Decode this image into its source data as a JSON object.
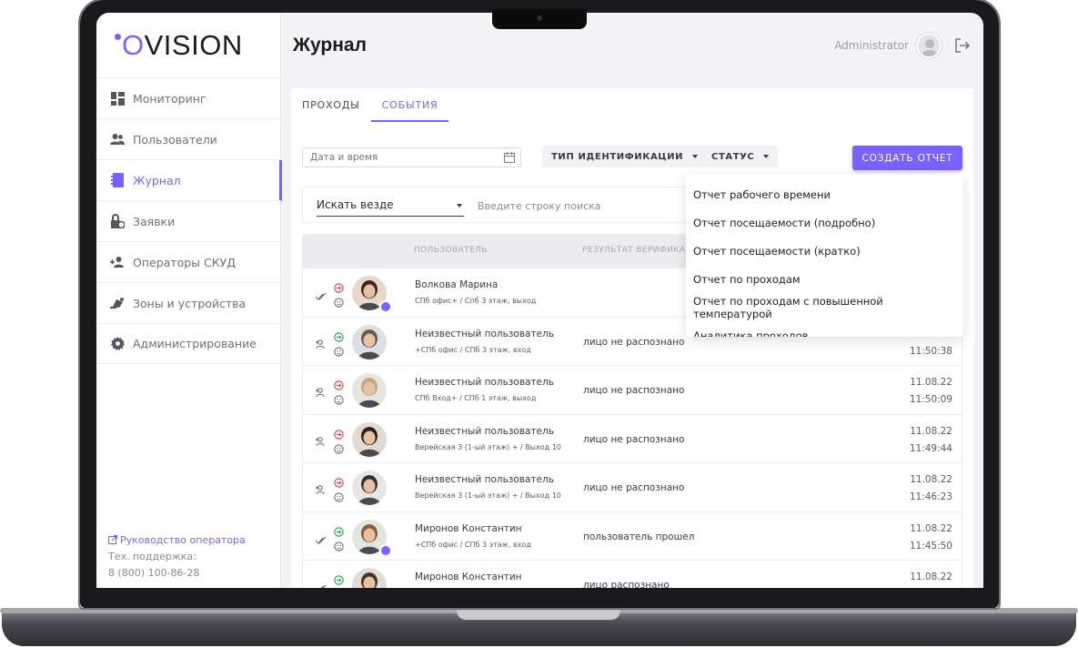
{
  "app": {
    "logo_text": "VISION",
    "logo_letter": "O",
    "accent_color": "#7b61ff"
  },
  "sidebar": {
    "items": [
      {
        "label": "Мониторинг",
        "icon": "dashboard-icon"
      },
      {
        "label": "Пользователи",
        "icon": "users-icon"
      },
      {
        "label": "Журнал",
        "icon": "journal-icon",
        "active": true
      },
      {
        "label": "Заявки",
        "icon": "request-icon"
      },
      {
        "label": "Операторы СКУД",
        "icon": "operator-icon"
      },
      {
        "label": "Зоны и устройства",
        "icon": "zones-icon"
      },
      {
        "label": "Администрирование",
        "icon": "gear-icon"
      }
    ],
    "footer": {
      "guide_link": "Руководство оператора",
      "support_label": "Тех. поддержка:",
      "support_phone": "8 (800) 100-86-28"
    }
  },
  "header": {
    "title": "Журнал",
    "user_name": "Administrator"
  },
  "tabs": [
    {
      "label": "ПРОХОДЫ",
      "active": false
    },
    {
      "label": "СОБЫТИЯ",
      "active": true
    }
  ],
  "filters": {
    "date_placeholder": "Дата и время",
    "identification_type": "ТИП ИДЕНТИФИКАЦИИ",
    "status": "СТАТУС",
    "create_report": "СОЗДАТЬ ОТЧЕТ"
  },
  "search": {
    "scope": "Искать везде",
    "placeholder": "Введите строку поиска"
  },
  "table": {
    "columns": {
      "user": "ПОЛЬЗОВАТЕЛЬ",
      "result": "РЕЗУЛЬТАТ ВЕРИФИКАЦ"
    },
    "rows": [
      {
        "name": "Волкова Марина",
        "location": "СПб офис+ / Спб 3 этаж, выход",
        "result": "",
        "date": "",
        "time": "",
        "direction": "out",
        "type": "check",
        "badge": true
      },
      {
        "name": "Неизвестный пользователь",
        "location": "+СПб офис / СПб 3 этаж, вход",
        "result": "лицо не распознано",
        "date": "",
        "time": "11:50:38",
        "direction": "in",
        "type": "unknown",
        "badge": false
      },
      {
        "name": "Неизвестный пользователь",
        "location": "СПб Вход+ / СПб 1 этаж, выход",
        "result": "лицо не распознано",
        "date": "11.08.22",
        "time": "11:50:09",
        "direction": "out",
        "type": "unknown",
        "badge": false
      },
      {
        "name": "Неизвестный пользователь",
        "location": "Верейская 3 (1-ый этаж) + / Выход 10",
        "result": "лицо не распознано",
        "date": "11.08.22",
        "time": "11:49:44",
        "direction": "out",
        "type": "unknown",
        "badge": false
      },
      {
        "name": "Неизвестный пользователь",
        "location": "Верейская 3 (1-ый этаж) + / Выход 10",
        "result": "лицо не распознано",
        "date": "11.08.22",
        "time": "11:46:23",
        "direction": "out",
        "type": "unknown",
        "badge": false
      },
      {
        "name": "Миронов Константин",
        "location": "+СПб офис / СПб 3 этаж, вход",
        "result": "пользователь прошел",
        "date": "11.08.22",
        "time": "11:45:50",
        "direction": "in",
        "type": "check",
        "badge": true
      },
      {
        "name": "Миронов Константин",
        "location": "",
        "result": "лицо распознано",
        "date": "11.08.22",
        "time": "",
        "direction": "in",
        "type": "check",
        "badge": false
      }
    ]
  },
  "report_menu": [
    "Отчет рабочего времени",
    "Отчет посещаемости (подробно)",
    "Отчет посещаемости (кратко)",
    "Отчет по проходам",
    "Отчет по проходам с повышенной температурой",
    "Аналитика проходов"
  ]
}
